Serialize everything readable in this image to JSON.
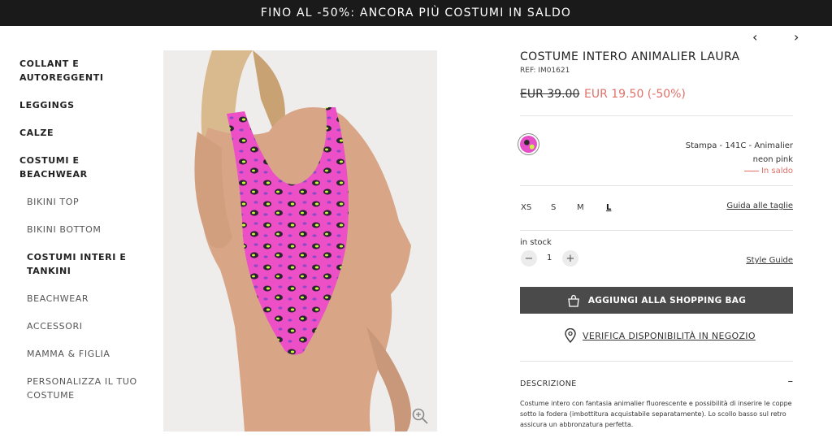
{
  "promo": {
    "text": "FINO AL -50%: ANCORA PIÙ COSTUMI IN SALDO"
  },
  "nav": {
    "items": [
      {
        "label": "COLLANT E AUTOREGGENTI",
        "level": "main"
      },
      {
        "label": "LEGGINGS",
        "level": "main"
      },
      {
        "label": "CALZE",
        "level": "main"
      },
      {
        "label": "COSTUMI E BEACHWEAR",
        "level": "main"
      },
      {
        "label": "BIKINI TOP",
        "level": "sub"
      },
      {
        "label": "BIKINI BOTTOM",
        "level": "sub"
      },
      {
        "label": "COSTUMI INTERI E TANKINI",
        "level": "sub-active"
      },
      {
        "label": "BEACHWEAR",
        "level": "sub"
      },
      {
        "label": "ACCESSORI",
        "level": "sub"
      },
      {
        "label": "MAMMA & FIGLIA",
        "level": "sub"
      },
      {
        "label": "PERSONALIZZA IL TUO COSTUME",
        "level": "sub"
      }
    ]
  },
  "product": {
    "title": "COSTUME INTERO ANIMALIER LAURA",
    "ref": "REF: IM01621",
    "price_old": "EUR 39.00",
    "price_new": "EUR 19.50 (-50%)",
    "color_name": "Stampa - 141C - Animalier neon pink",
    "sale_label": "In saldo",
    "sizes": [
      "XS",
      "S",
      "M",
      "L"
    ],
    "selected_size": "L",
    "size_guide": "Guida alle taglie",
    "stock": "in stock",
    "quantity": "1",
    "style_guide": "Style Guide",
    "add_to_bag": "AGGIUNGI ALLA SHOPPING BAG",
    "store_check": "VERIFICA DISPONIBILITÀ IN NEGOZIO",
    "description_heading": "DESCRIZIONE",
    "description_toggle": "–",
    "description_text": "Costume intero con fantasia animalier fluorescente e possibilità di inserire le coppe sotto la fodera (imbottitura acquistabile separatamente). Lo scollo basso sul retro assicura un abbronzatura perfetta."
  },
  "colors": {
    "accent_sale": "#e0706a",
    "button_bg": "#4a4a4a",
    "promo_bg": "#1a1a1a",
    "swimsuit": "#e54fc8"
  },
  "icons": {
    "prev": "chevron-left-icon",
    "next": "chevron-right-icon",
    "zoom": "zoom-icon",
    "bag": "shopping-bag-icon",
    "location": "location-pin-icon"
  }
}
